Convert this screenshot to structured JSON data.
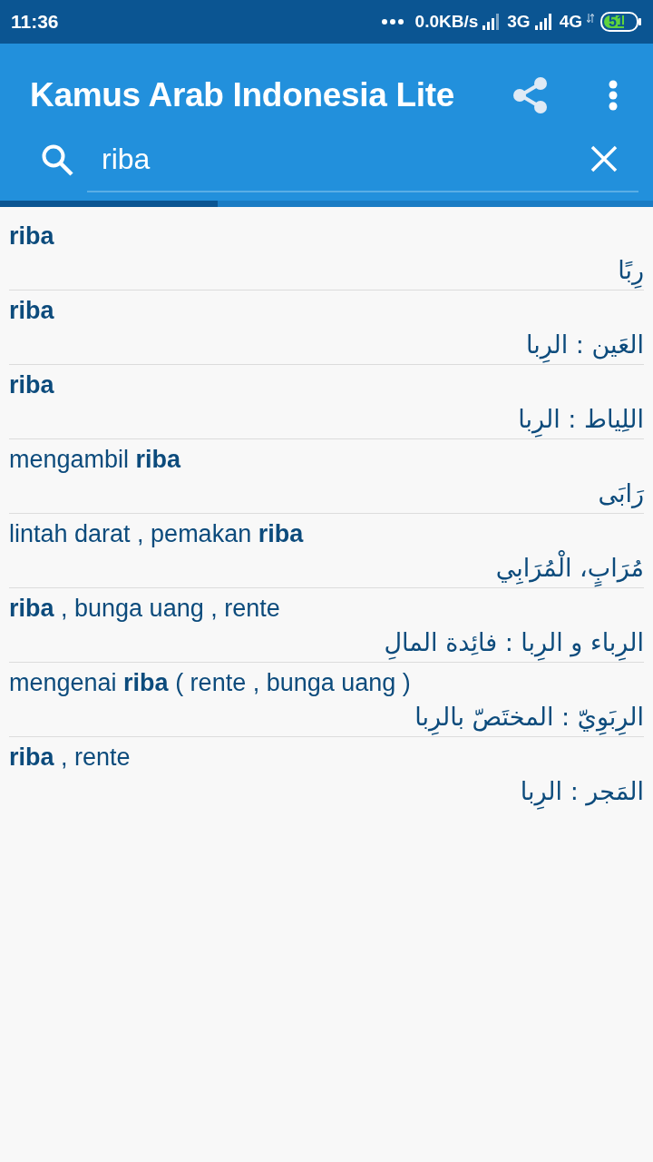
{
  "status_bar": {
    "time": "11:36",
    "net_speed": "0.0KB/s",
    "network_1": "3G",
    "network_2": "4G",
    "battery": "51"
  },
  "app_bar": {
    "title": "Kamus Arab Indonesia Lite"
  },
  "search": {
    "value": "riba"
  },
  "progress": {
    "level": 0.333
  },
  "results": [
    {
      "indonesian": "riba",
      "bold": true,
      "arabic": "رِبًا"
    },
    {
      "indonesian": "riba",
      "bold": true,
      "arabic": "العَين : الرِبا"
    },
    {
      "indonesian": "riba",
      "bold": true,
      "arabic": "اللِياط : الرِبا"
    },
    {
      "indonesian": "mengambil **riba**",
      "bold": false,
      "arabic": "رَابَى"
    },
    {
      "indonesian": "lintah darat , pemakan **riba**",
      "bold": false,
      "arabic": "مُرَابٍ، الْمُرَابِي"
    },
    {
      "indonesian": "**riba** , bunga uang , rente",
      "bold": false,
      "arabic": "الرِباء و الرِبا : فائِدة المالِ"
    },
    {
      "indonesian": "mengenai **riba** ( rente , bunga uang )",
      "bold": false,
      "arabic": "الرِبَوِيّ : المختَصّ بالرِبا"
    },
    {
      "indonesian": "**riba** , rente",
      "bold": false,
      "arabic": "المَجر : الرِبا"
    }
  ]
}
